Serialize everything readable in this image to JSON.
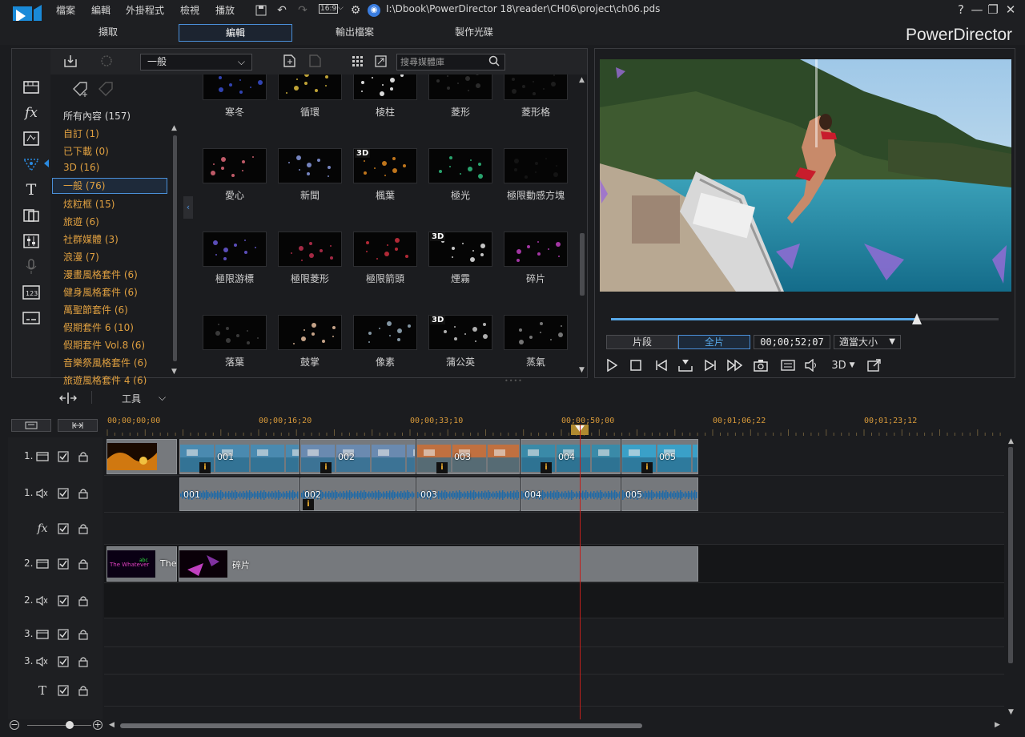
{
  "app": {
    "name": "PowerDirector",
    "file_path": "I:\\Dbook\\PowerDirector 18\\reader\\CH06\\project\\ch06.pds"
  },
  "menu": [
    "檔案",
    "編輯",
    "外掛程式",
    "檢視",
    "播放"
  ],
  "toolbar": {
    "aspect": "16:9"
  },
  "window_controls": [
    "?",
    "—",
    "❐",
    "✕"
  ],
  "tabs": [
    {
      "label": "擷取",
      "active": false
    },
    {
      "label": "編輯",
      "active": true
    },
    {
      "label": "輸出檔案",
      "active": false
    },
    {
      "label": "製作光碟",
      "active": false
    }
  ],
  "library": {
    "category_select": "一般",
    "search_placeholder": "搜尋媒體庫",
    "categories": [
      {
        "label": "所有內容 (157)",
        "kind": "all"
      },
      {
        "label": "自訂 (1)"
      },
      {
        "label": "已下載 (0)"
      },
      {
        "label": "3D (16)"
      },
      {
        "label": "一般 (76)",
        "selected": true
      },
      {
        "label": "炫粒框 (15)"
      },
      {
        "label": "旅遊 (6)"
      },
      {
        "label": "社群媒體 (3)"
      },
      {
        "label": "浪漫 (7)"
      },
      {
        "label": "漫畫風格套件 (6)"
      },
      {
        "label": "健身風格套件 (6)"
      },
      {
        "label": "萬聖節套件 (6)"
      },
      {
        "label": "假期套件 6 (10)"
      },
      {
        "label": "假期套件 Vol.8 (6)"
      },
      {
        "label": "音樂祭風格套件 (6)"
      },
      {
        "label": "旅遊風格套件 4 (6)"
      }
    ],
    "items": [
      {
        "label": "寒冬",
        "is3d": false,
        "color": "#3a4fd0"
      },
      {
        "label": "循環",
        "is3d": false,
        "color": "#e0c040"
      },
      {
        "label": "棱柱",
        "is3d": false,
        "color": "#ffffff"
      },
      {
        "label": "菱形",
        "is3d": false,
        "color": "#333333"
      },
      {
        "label": "菱形格",
        "is3d": false,
        "color": "#222222"
      },
      {
        "label": "愛心",
        "is3d": false,
        "color": "#e06a7a"
      },
      {
        "label": "新聞",
        "is3d": false,
        "color": "#8a9be0"
      },
      {
        "label": "楓葉",
        "is3d": true,
        "color": "#e08a20"
      },
      {
        "label": "極光",
        "is3d": false,
        "color": "#30c080"
      },
      {
        "label": "極限動感方塊",
        "is3d": false,
        "color": "#181818"
      },
      {
        "label": "極限游標",
        "is3d": false,
        "color": "#6a5ad8"
      },
      {
        "label": "極限菱形",
        "is3d": false,
        "color": "#c03050"
      },
      {
        "label": "極限箭頭",
        "is3d": false,
        "color": "#d03040"
      },
      {
        "label": "煙霧",
        "is3d": true,
        "color": "#e8e8e8"
      },
      {
        "label": "碎片",
        "is3d": false,
        "color": "#c040c0"
      },
      {
        "label": "落葉",
        "is3d": false,
        "color": "#444444"
      },
      {
        "label": "鼓掌",
        "is3d": false,
        "color": "#e8c0a0"
      },
      {
        "label": "像素",
        "is3d": false,
        "color": "#9ab0c0"
      },
      {
        "label": "蒲公英",
        "is3d": true,
        "color": "#cccccc"
      },
      {
        "label": "蒸氣",
        "is3d": false,
        "color": "#8a8a8a"
      }
    ]
  },
  "preview": {
    "mode_clip": "片段",
    "mode_movie": "全片",
    "timecode": "00;00;52;07",
    "fit": "適當大小",
    "seek_fraction": 0.79,
    "threed": "3D"
  },
  "timeline": {
    "tools_label": "工具",
    "ruler": [
      "00;00;00;00",
      "00;00;16;20",
      "00;00;33;10",
      "00;00;50;00",
      "00;01;06;22",
      "00;01;23;12"
    ],
    "tracks": [
      {
        "num": "1.",
        "type": "video"
      },
      {
        "num": "1.",
        "type": "audio"
      },
      {
        "num": "",
        "type": "fx"
      },
      {
        "num": "2.",
        "type": "video"
      },
      {
        "num": "2.",
        "type": "audio"
      },
      {
        "num": "3.",
        "type": "video"
      },
      {
        "num": "3.",
        "type": "audio"
      },
      {
        "num": "",
        "type": "title"
      }
    ],
    "video_clips": [
      "001",
      "002",
      "003",
      "004",
      "005"
    ],
    "audio_clips": [
      "001",
      "002",
      "003",
      "004",
      "005"
    ],
    "overlay_clips": [
      {
        "label": "The"
      },
      {
        "label": "碎片"
      }
    ]
  }
}
